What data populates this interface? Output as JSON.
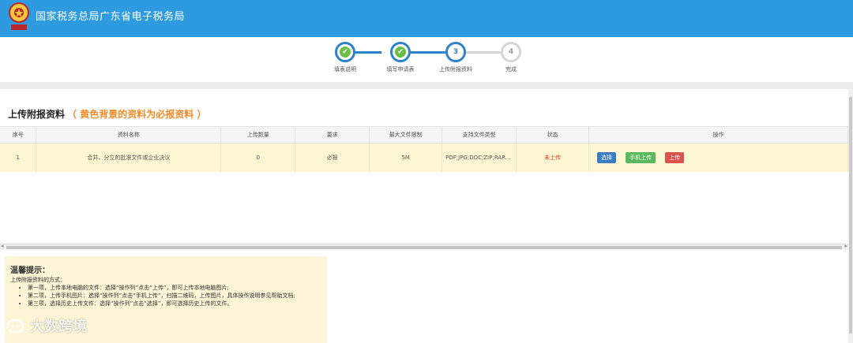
{
  "header": {
    "title": "国家税务总局广东省电子税务局",
    "bg_color": "#2e9ae0"
  },
  "steps": [
    {
      "label": "填表说明",
      "state": "done",
      "number": ""
    },
    {
      "label": "填写申请表",
      "state": "done",
      "number": ""
    },
    {
      "label": "上传附报资料",
      "state": "current",
      "number": "3"
    },
    {
      "label": "完成",
      "state": "todo",
      "number": "4"
    }
  ],
  "section": {
    "title": "上传附报资料",
    "note": "（ 黄色背景的资料为必报资料 ）"
  },
  "table": {
    "headers": [
      "序号",
      "资料名称",
      "上传数量",
      "要求",
      "最大文件限制",
      "支持文件类型",
      "状态",
      "操作"
    ],
    "rows": [
      {
        "index": "1",
        "name": "合并、分立的批准文件或企业决议",
        "count": "0",
        "requirement": "必报",
        "max_size": "5M",
        "file_types": "PDF;JPG;DOC;ZIP;RAR...",
        "status": "未上传",
        "actions": [
          "选择",
          "手机上传",
          "上传"
        ]
      }
    ]
  },
  "tips": {
    "title": "温馨提示：",
    "intro": "上传附报资料的方式：",
    "items": [
      "第一项，上传本地电脑的文件：选择“操作列”点击“上传”，即可上传本地电脑图片;",
      "第二项，上传手机图片：选择“操作列”点击“手机上传”，扫描二维码，上传图片，具体操作说明参见帮助文档;",
      "第三项，选择历史上传文件：选择“操作列”点击“选择”，即可选择历史上传的文件。"
    ]
  },
  "watermark": {
    "text": "大数跨境"
  },
  "colors": {
    "accent": "#2e82c8",
    "done": "#6cc04a",
    "warning": "#f08c28",
    "status_red": "#e53b2c",
    "highlight_row": "#fdf6d3"
  }
}
